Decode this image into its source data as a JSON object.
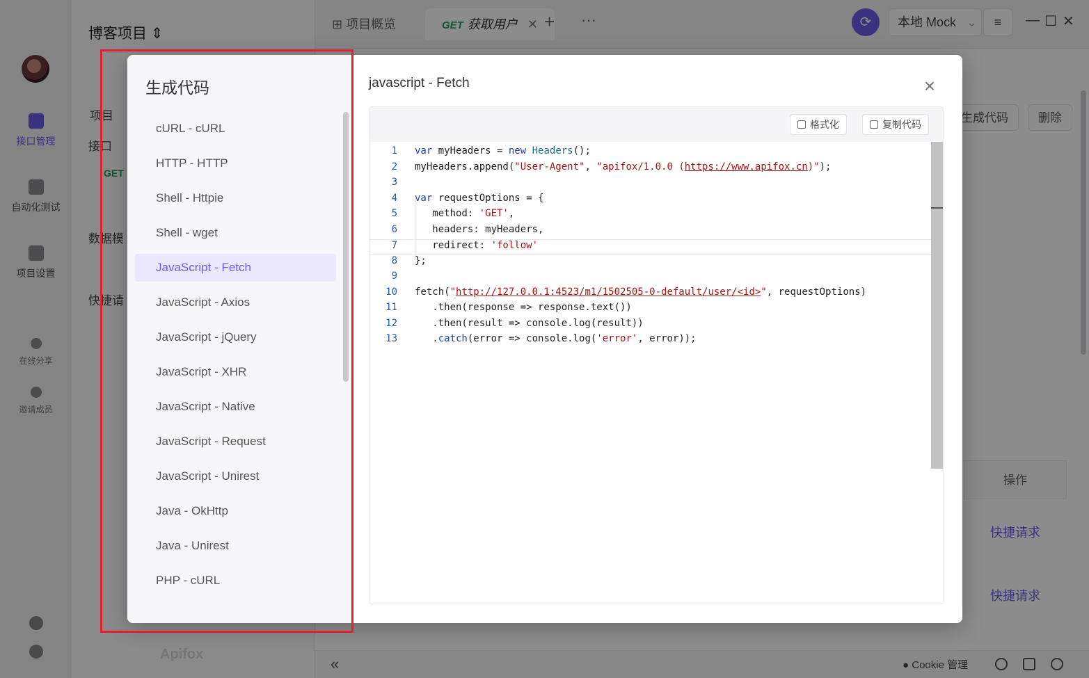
{
  "app": {
    "project_title": "博客项目",
    "left_nav": [
      {
        "label": "接口管理",
        "icon": "api-icon"
      },
      {
        "label": "自动化测试",
        "icon": "test-icon"
      },
      {
        "label": "项目设置",
        "icon": "settings-icon"
      }
    ],
    "share_label": "在线分享",
    "invite_label": "邀请成员",
    "sidebar_texts": [
      "项目",
      "接口",
      "数据模",
      "快捷请"
    ],
    "get_tag": "GET",
    "brand": "Apifox"
  },
  "topbar": {
    "tabs": [
      {
        "label": "项目概览",
        "method": ""
      },
      {
        "label": "获取用户",
        "method": "GET"
      }
    ],
    "plus": "+",
    "more": "···",
    "env_select": "本地 Mock",
    "menu_icon": "≡",
    "win_min": "—",
    "win_max": "☐",
    "win_close": "✕"
  },
  "main": {
    "gen_code_btn": "生成代码",
    "delete_btn": "删除",
    "table_head": "操作",
    "quick_links": [
      "快捷请求",
      "快捷请求"
    ]
  },
  "statusbar": {
    "collapse": "«",
    "cookie": "Cookie 管理"
  },
  "modal": {
    "heading": "生成代码",
    "languages": [
      "cURL - cURL",
      "HTTP - HTTP",
      "Shell - Httpie",
      "Shell - wget",
      "JavaScript - Fetch",
      "JavaScript - Axios",
      "JavaScript - jQuery",
      "JavaScript - XHR",
      "JavaScript - Native",
      "JavaScript - Request",
      "JavaScript - Unirest",
      "Java - OkHttp",
      "Java - Unirest",
      "PHP - cURL"
    ],
    "selected_index": 4,
    "code_title": "javascript - Fetch",
    "close": "×",
    "format_btn": "格式化",
    "copy_btn": "复制代码",
    "code_lines": [
      "var myHeaders = new Headers();",
      "myHeaders.append(\"User-Agent\", \"apifox/1.0.0 (https://www.apifox.cn)\");",
      "",
      "var requestOptions = {",
      "   method: 'GET',",
      "   headers: myHeaders,",
      "   redirect: 'follow'",
      "};",
      "",
      "fetch(\"http://127.0.0.1:4523/m1/1502505-0-default/user/<id>\", requestOptions)",
      "   .then(response => response.text())",
      "   .then(result => console.log(result))",
      "   .catch(error => console.log('error', error));"
    ],
    "current_line": 7
  },
  "colors": {
    "accent": "#6c5ce7",
    "highlight_border": "#e0202a",
    "get_method": "#1a9b5a"
  }
}
